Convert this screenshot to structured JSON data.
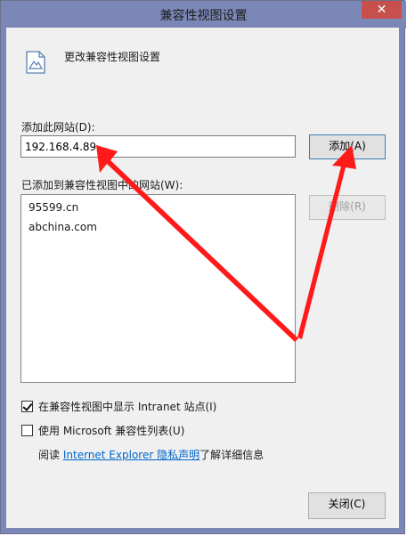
{
  "window": {
    "title": "兼容性视图设置",
    "close_glyph": "✕"
  },
  "header": {
    "icon": "document-image-icon",
    "text": "更改兼容性视图设置"
  },
  "add_site": {
    "label": "添加此网站(D):",
    "value": "192.168.4.89",
    "button_label": "添加(A)"
  },
  "site_list": {
    "label": "已添加到兼容性视图中的网站(W):",
    "items": [
      {
        "text": "95599.cn"
      },
      {
        "text": "abchina.com"
      }
    ],
    "remove_label": "删除(R)"
  },
  "options": {
    "intranet_label": "在兼容性视图中显示 Intranet 站点(I)",
    "intranet_checked": true,
    "ms_list_label": "使用 Microsoft 兼容性列表(U)",
    "ms_list_checked": false
  },
  "privacy": {
    "prefix": "阅读",
    "link_text": "Internet Explorer 隐私声明",
    "suffix": "了解详细信息"
  },
  "footer": {
    "close_label": "关闭(C)"
  },
  "colors": {
    "annotation_arrow": "#ff1a1a",
    "titlebar": "#7b88b7",
    "close_button": "#c7504c",
    "link": "#0066cc"
  }
}
